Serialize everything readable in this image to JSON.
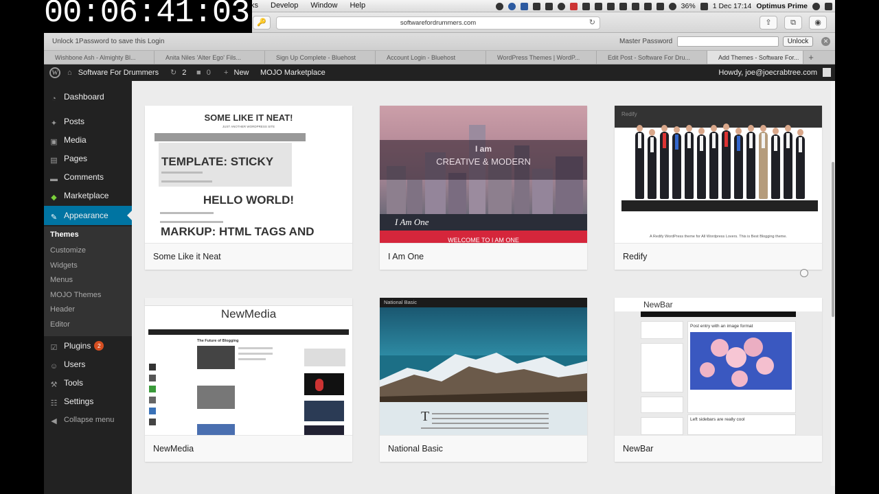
{
  "timer": "00:06:41:03",
  "menubar": {
    "menus": [
      "ks",
      "Develop",
      "Window",
      "Help"
    ],
    "battery": "36%",
    "datetime": "1 Dec 17:14",
    "user": "Optimus Prime"
  },
  "browser": {
    "url": "softwarefordrummers.com",
    "onepassword": {
      "message": "Unlock 1Password to save this Login",
      "master_password_label": "Master Password",
      "master_password_value": "",
      "unlock_label": "Unlock"
    },
    "tabs": [
      "Wishbone Ash - Almighty Bl...",
      "Anita Niles 'Alter Ego' Fils...",
      "Sign Up Complete - Bluehost",
      "Account Login - Bluehost",
      "WordPress Themes | WordP...",
      "Edit Post - Software For Dru...",
      "Add Themes - Software For..."
    ],
    "active_tab_index": 6
  },
  "adminbar": {
    "site": "Software For Drummers",
    "updates": "2",
    "comments": "0",
    "new_label": "New",
    "mojo_label": "MOJO Marketplace",
    "howdy": "Howdy, joe@joecrabtree.com"
  },
  "sidebar": {
    "items": [
      {
        "label": "Dashboard",
        "icon": "dashboard-icon"
      },
      {
        "label": "Posts",
        "icon": "pin-icon"
      },
      {
        "label": "Media",
        "icon": "media-icon"
      },
      {
        "label": "Pages",
        "icon": "pages-icon"
      },
      {
        "label": "Comments",
        "icon": "comment-icon"
      },
      {
        "label": "Marketplace",
        "icon": "marketplace-icon"
      },
      {
        "label": "Appearance",
        "icon": "brush-icon"
      }
    ],
    "submenu": [
      "Themes",
      "Customize",
      "Widgets",
      "Menus",
      "MOJO Themes",
      "Header",
      "Editor"
    ],
    "items_after": [
      {
        "label": "Plugins",
        "icon": "plugin-icon",
        "badge": "2"
      },
      {
        "label": "Users",
        "icon": "users-icon"
      },
      {
        "label": "Tools",
        "icon": "wrench-icon"
      },
      {
        "label": "Settings",
        "icon": "settings-icon"
      }
    ],
    "collapse": "Collapse menu"
  },
  "themes": [
    {
      "name": "Some Like it Neat",
      "preview": {
        "title": "SOME LIKE IT NEAT!",
        "subtitle": "JUST ANOTHER WORDPRESS SITE",
        "post1": "TEMPLATE: STICKY",
        "post2": "HELLO WORLD!",
        "post3": "MARKUP: HTML TAGS AND"
      }
    },
    {
      "name": "I Am One",
      "preview": {
        "line1": "I am",
        "line2": "CREATIVE & MODERN",
        "logo": "I Am One",
        "welcome": "WELCOME TO I AM ONE"
      }
    },
    {
      "name": "Redify",
      "preview": {
        "logo": "Redify",
        "tagline": "A Redify WordPress theme for All Wordpress Lovers. This is Best Blogging theme."
      }
    },
    {
      "name": "NewMedia",
      "preview": {
        "logo": "NewMedia",
        "heading": "The Future of Blogging"
      }
    },
    {
      "name": "National Basic",
      "preview": {
        "logo": "National Basic",
        "dropcap": "T"
      }
    },
    {
      "name": "NewBar",
      "preview": {
        "logo": "NewBar",
        "post1": "Post entry with an image format",
        "post2": "Left sidebars are really cool"
      }
    }
  ],
  "colors": {
    "admin_dark": "#222222",
    "active_blue": "#0074a2",
    "badge_orange": "#d54e21"
  }
}
